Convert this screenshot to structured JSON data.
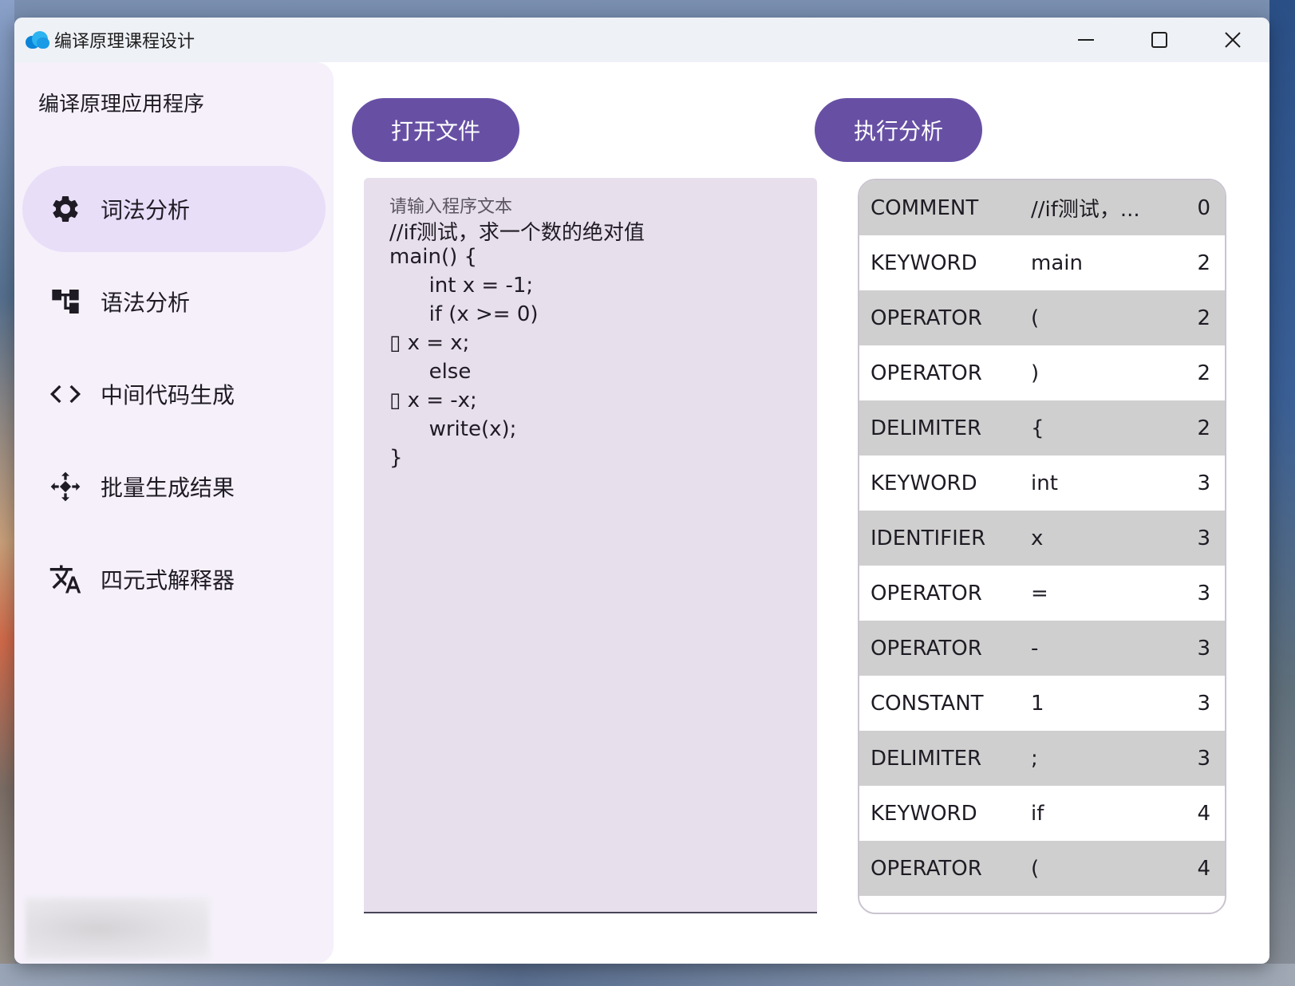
{
  "window": {
    "title": "编译原理课程设计"
  },
  "sidebar": {
    "title": "编译原理应用程序",
    "items": [
      {
        "label": "词法分析",
        "icon": "gear-icon",
        "active": true
      },
      {
        "label": "语法分析",
        "icon": "tree-icon",
        "active": false
      },
      {
        "label": "中间代码生成",
        "icon": "code-icon",
        "active": false
      },
      {
        "label": "批量生成结果",
        "icon": "diamond-arrows-icon",
        "active": false
      },
      {
        "label": "四元式解释器",
        "icon": "translate-icon",
        "active": false
      }
    ]
  },
  "toolbar": {
    "open_label": "打开文件",
    "run_label": "执行分析"
  },
  "editor": {
    "placeholder": "请输入程序文本",
    "lines": [
      "//if测试，求一个数的绝对值",
      "main() {",
      "      int x = -1;",
      "      if (x >= 0)",
      "▯ x = x;",
      "      else",
      "▯ x = -x;",
      "      write(x);",
      "}"
    ]
  },
  "tokens": [
    {
      "type": "COMMENT",
      "value": "//if测试，...",
      "line": "0"
    },
    {
      "type": "KEYWORD",
      "value": "main",
      "line": "2"
    },
    {
      "type": "OPERATOR",
      "value": "(",
      "line": "2"
    },
    {
      "type": "OPERATOR",
      "value": ")",
      "line": "2"
    },
    {
      "type": "DELIMITER",
      "value": "{",
      "line": "2"
    },
    {
      "type": "KEYWORD",
      "value": "int",
      "line": "3"
    },
    {
      "type": "IDENTIFIER",
      "value": "x",
      "line": "3"
    },
    {
      "type": "OPERATOR",
      "value": "=",
      "line": "3"
    },
    {
      "type": "OPERATOR",
      "value": "-",
      "line": "3"
    },
    {
      "type": "CONSTANT",
      "value": "1",
      "line": "3"
    },
    {
      "type": "DELIMITER",
      "value": ";",
      "line": "3"
    },
    {
      "type": "KEYWORD",
      "value": "if",
      "line": "4"
    },
    {
      "type": "OPERATOR",
      "value": "(",
      "line": "4"
    }
  ],
  "colors": {
    "accent": "#6750a4",
    "nav_active": "#e8def8",
    "sidebar_bg": "#f5f0fa",
    "editor_bg": "#e7dfec",
    "row_shade": "#cfcfcf"
  }
}
